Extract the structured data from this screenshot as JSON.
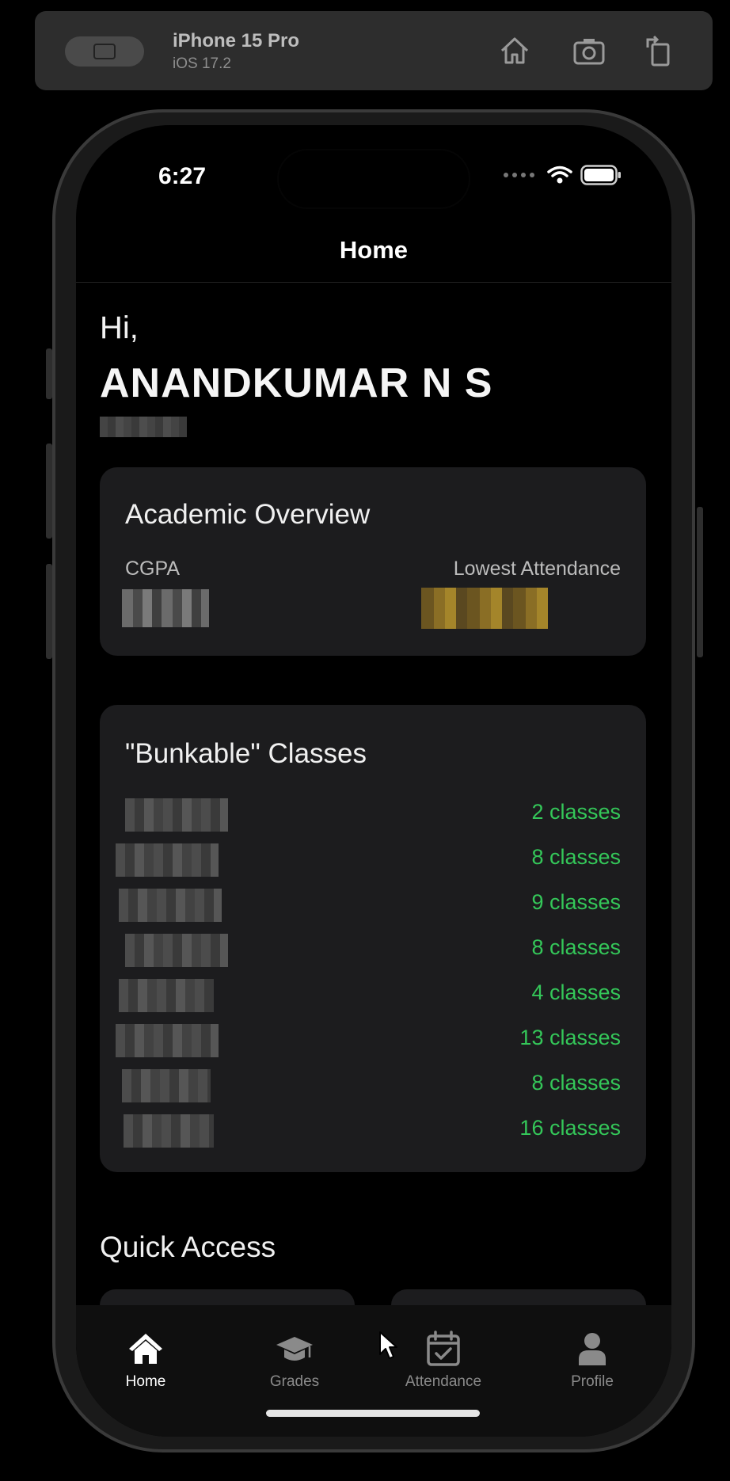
{
  "simulator": {
    "device_name": "iPhone 15 Pro",
    "os_version": "iOS 17.2",
    "icons": [
      "home-icon",
      "screenshot-icon",
      "rotate-icon"
    ]
  },
  "status_bar": {
    "time": "6:27"
  },
  "nav": {
    "title": "Home"
  },
  "greeting": {
    "hi": "Hi,",
    "name": "ANANDKUMAR  N S"
  },
  "academic_overview": {
    "title": "Academic Overview",
    "cgpa_label": "CGPA",
    "lowest_attendance_label": "Lowest Attendance"
  },
  "bunkable": {
    "title": "\"Bunkable\" Classes",
    "rows": [
      {
        "count": "2 classes"
      },
      {
        "count": "8 classes"
      },
      {
        "count": "9 classes"
      },
      {
        "count": "8 classes"
      },
      {
        "count": "4 classes"
      },
      {
        "count": "13 classes"
      },
      {
        "count": "8 classes"
      },
      {
        "count": "16 classes"
      }
    ]
  },
  "quick_access": {
    "title": "Quick Access"
  },
  "tabs": [
    {
      "label": "Home",
      "icon": "house-icon",
      "active": true
    },
    {
      "label": "Grades",
      "icon": "graduation-cap-icon",
      "active": false
    },
    {
      "label": "Attendance",
      "icon": "calendar-check-icon",
      "active": false
    },
    {
      "label": "Profile",
      "icon": "person-icon",
      "active": false
    }
  ],
  "colors": {
    "accent_green": "#34c759",
    "card_bg": "#1c1c1e"
  }
}
